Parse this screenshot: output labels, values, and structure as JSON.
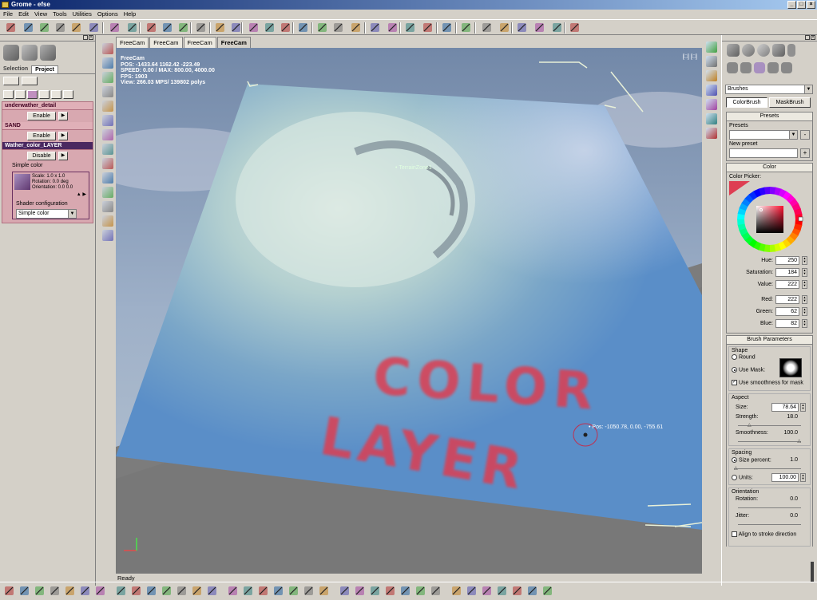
{
  "window": {
    "title": "Grome - efse"
  },
  "menu": [
    "File",
    "Edit",
    "View",
    "Tools",
    "Utilities",
    "Options",
    "Help"
  ],
  "left_panel": {
    "tabs": [
      "Selection",
      "Project"
    ],
    "active_tab": "Project",
    "layers": [
      {
        "name": "underwather_detail",
        "button": "Enable"
      },
      {
        "name": "SAND",
        "button": "Enable"
      },
      {
        "name": "Wather_color_LAYER",
        "button": "Disable",
        "selected": true
      }
    ],
    "simple_color_label": "Simple color",
    "scale": "Scale: 1.0 x 1.0",
    "rotation": "Rotation: 0.0 deg",
    "orientation": "Orientation: 0.0 0.0",
    "shader_config_label": "Shader configuration",
    "shader_value": "Simple color"
  },
  "viewport": {
    "tabs": [
      "FreeCam",
      "FreeCam",
      "FreeCam",
      "FreeCam"
    ],
    "active_tab_index": 3,
    "hud": {
      "cam": "FreeCam",
      "pos": "POS: -1433.64 1162.42 -223.49",
      "speed": "SPEED: 0.00 / MAX: 800.00, 4000.00",
      "fps": "FPS: 1903",
      "view": "View: 266.03 MPS/ 139802 polys"
    },
    "zone_label": "TerrainZone1",
    "cursor_pos": "Pos: -1050.78, 0.00, -755.61",
    "painted_text_line1": "COLOR",
    "painted_text_line2": "LAYER",
    "paint_color": "#dc3e52"
  },
  "status": "Ready",
  "right_panel": {
    "dropdown": "Brushes",
    "tabs": [
      "ColorBrush",
      "MaskBrush"
    ],
    "presets": {
      "title": "Presets",
      "presets_label": "Presets",
      "new_preset_label": "New preset",
      "minus": "-",
      "plus": "+"
    },
    "color": {
      "title": "Color",
      "picker_label": "Color Picker:",
      "swatch": "#de3e52",
      "hue_label": "Hue:",
      "hue": "250",
      "sat_label": "Saturation:",
      "sat": "184",
      "val_label": "Value:",
      "val": "222",
      "red_label": "Red:",
      "red": "222",
      "green_label": "Green:",
      "green": "62",
      "blue_label": "Blue:",
      "blue": "82"
    },
    "brush": {
      "title": "Brush Parameters",
      "shape_label": "Shape",
      "round": "Round",
      "use_mask": "Use Mask:",
      "smooth_mask": "Use smoothness for mask",
      "aspect_label": "Aspect",
      "size_label": "Size:",
      "size": "78.64",
      "strength_label": "Strength:",
      "strength": "18.0",
      "smooth_label": "Smoothness:",
      "smooth": "100.0",
      "spacing_label": "Spacing",
      "size_percent": "Size percent:",
      "size_percent_val": "1.0",
      "units": "Units:",
      "units_val": "100.00",
      "orient_label": "Orientation",
      "rotation_label": "Rotation:",
      "rotation": "0.0",
      "jitter_label": "Jitter:",
      "jitter": "0.0",
      "align": "Align to stroke direction"
    }
  }
}
